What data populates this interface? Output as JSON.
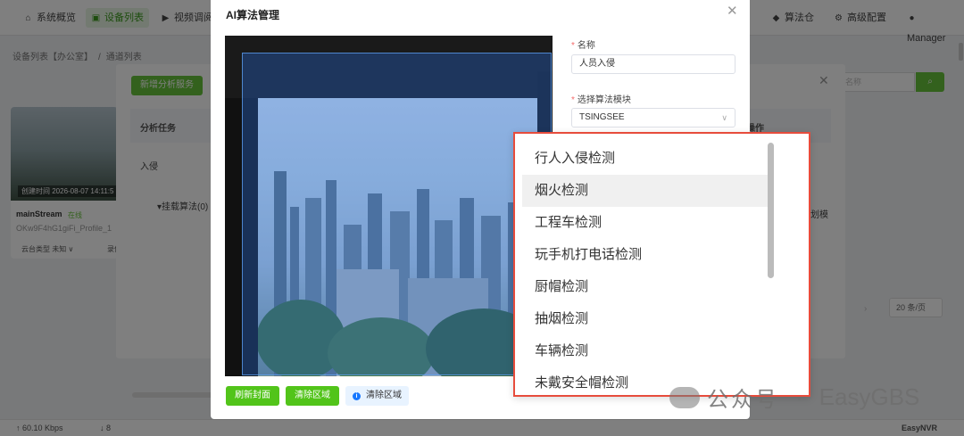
{
  "nav": {
    "items": [
      {
        "label": "系统概览",
        "icon": "home-icon"
      },
      {
        "label": "设备列表",
        "icon": "device-icon",
        "active": true
      },
      {
        "label": "视频调阅",
        "icon": "play-icon"
      },
      {
        "label": "算法仓",
        "icon": "dropbox-icon"
      },
      {
        "label": "高级配置",
        "icon": "gear-icon"
      },
      {
        "label": "Manager",
        "icon": "user-icon"
      }
    ]
  },
  "breadcrumb": {
    "parent": "设备列表【办公室】",
    "separator": "/",
    "current": "通道列表"
  },
  "panel": {
    "add_button": "新增分析服务",
    "columns": {
      "task": "分析任务",
      "action": "操作"
    },
    "row_task": "入侵",
    "row_algo": "▾挂载算法(0)",
    "row_action_fragment": "划模",
    "search_placeholder": "名称"
  },
  "card": {
    "created": "创建时间 2026-08-07 14:11:5",
    "name": "mainStream",
    "status": "在线",
    "profile": "OKw9F4hG1giFi_Profile_1",
    "ptz": "云台类型 未知 ∨",
    "record": "录像"
  },
  "pagination": {
    "page_size": "20 条/页"
  },
  "bottom": {
    "speed_up": "↑ 60.10 Kbps",
    "speed_down": "↓ 8",
    "brand": "EasyNVR"
  },
  "modal": {
    "title": "AI算法管理",
    "name_label": "名称",
    "name_value": "人员入侵",
    "module_label": "选择算法模块",
    "module_value": "TSINGSEE",
    "buttons": {
      "refresh": "刷新封面",
      "clear": "清除区域",
      "clear_info": "清除区域"
    }
  },
  "dropdown": {
    "options": [
      "行人入侵检测",
      "烟火检测",
      "工程车检测",
      "玩手机打电话检测",
      "厨帽检测",
      "抽烟检测",
      "车辆检测",
      "未戴安全帽检测"
    ],
    "hovered_index": 1
  },
  "watermark": {
    "label": "公众号",
    "separator": "·",
    "brand": "EasyGBS"
  }
}
